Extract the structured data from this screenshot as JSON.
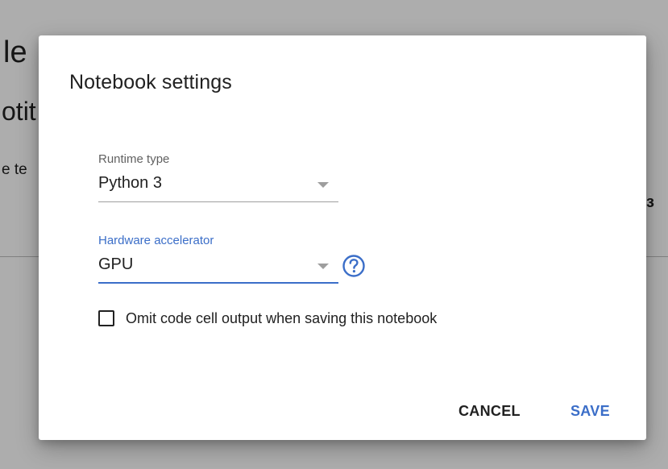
{
  "background": {
    "title_fragment": "le",
    "subtitle_fragment": "otit",
    "text_fragment": "e te",
    "right_fragment": "ɜ"
  },
  "dialog": {
    "title": "Notebook settings",
    "runtime": {
      "label": "Runtime type",
      "value": "Python 3"
    },
    "hardware": {
      "label": "Hardware accelerator",
      "value": "GPU"
    },
    "omit_output": {
      "label": "Omit code cell output when saving this notebook",
      "checked": false
    },
    "buttons": {
      "cancel": "CANCEL",
      "save": "SAVE"
    }
  },
  "colors": {
    "accent": "#3b6ec8",
    "text": "#212121",
    "muted": "#616161"
  },
  "icons": {
    "dropdown": "triangle-down-icon",
    "help": "help-circle-icon"
  }
}
